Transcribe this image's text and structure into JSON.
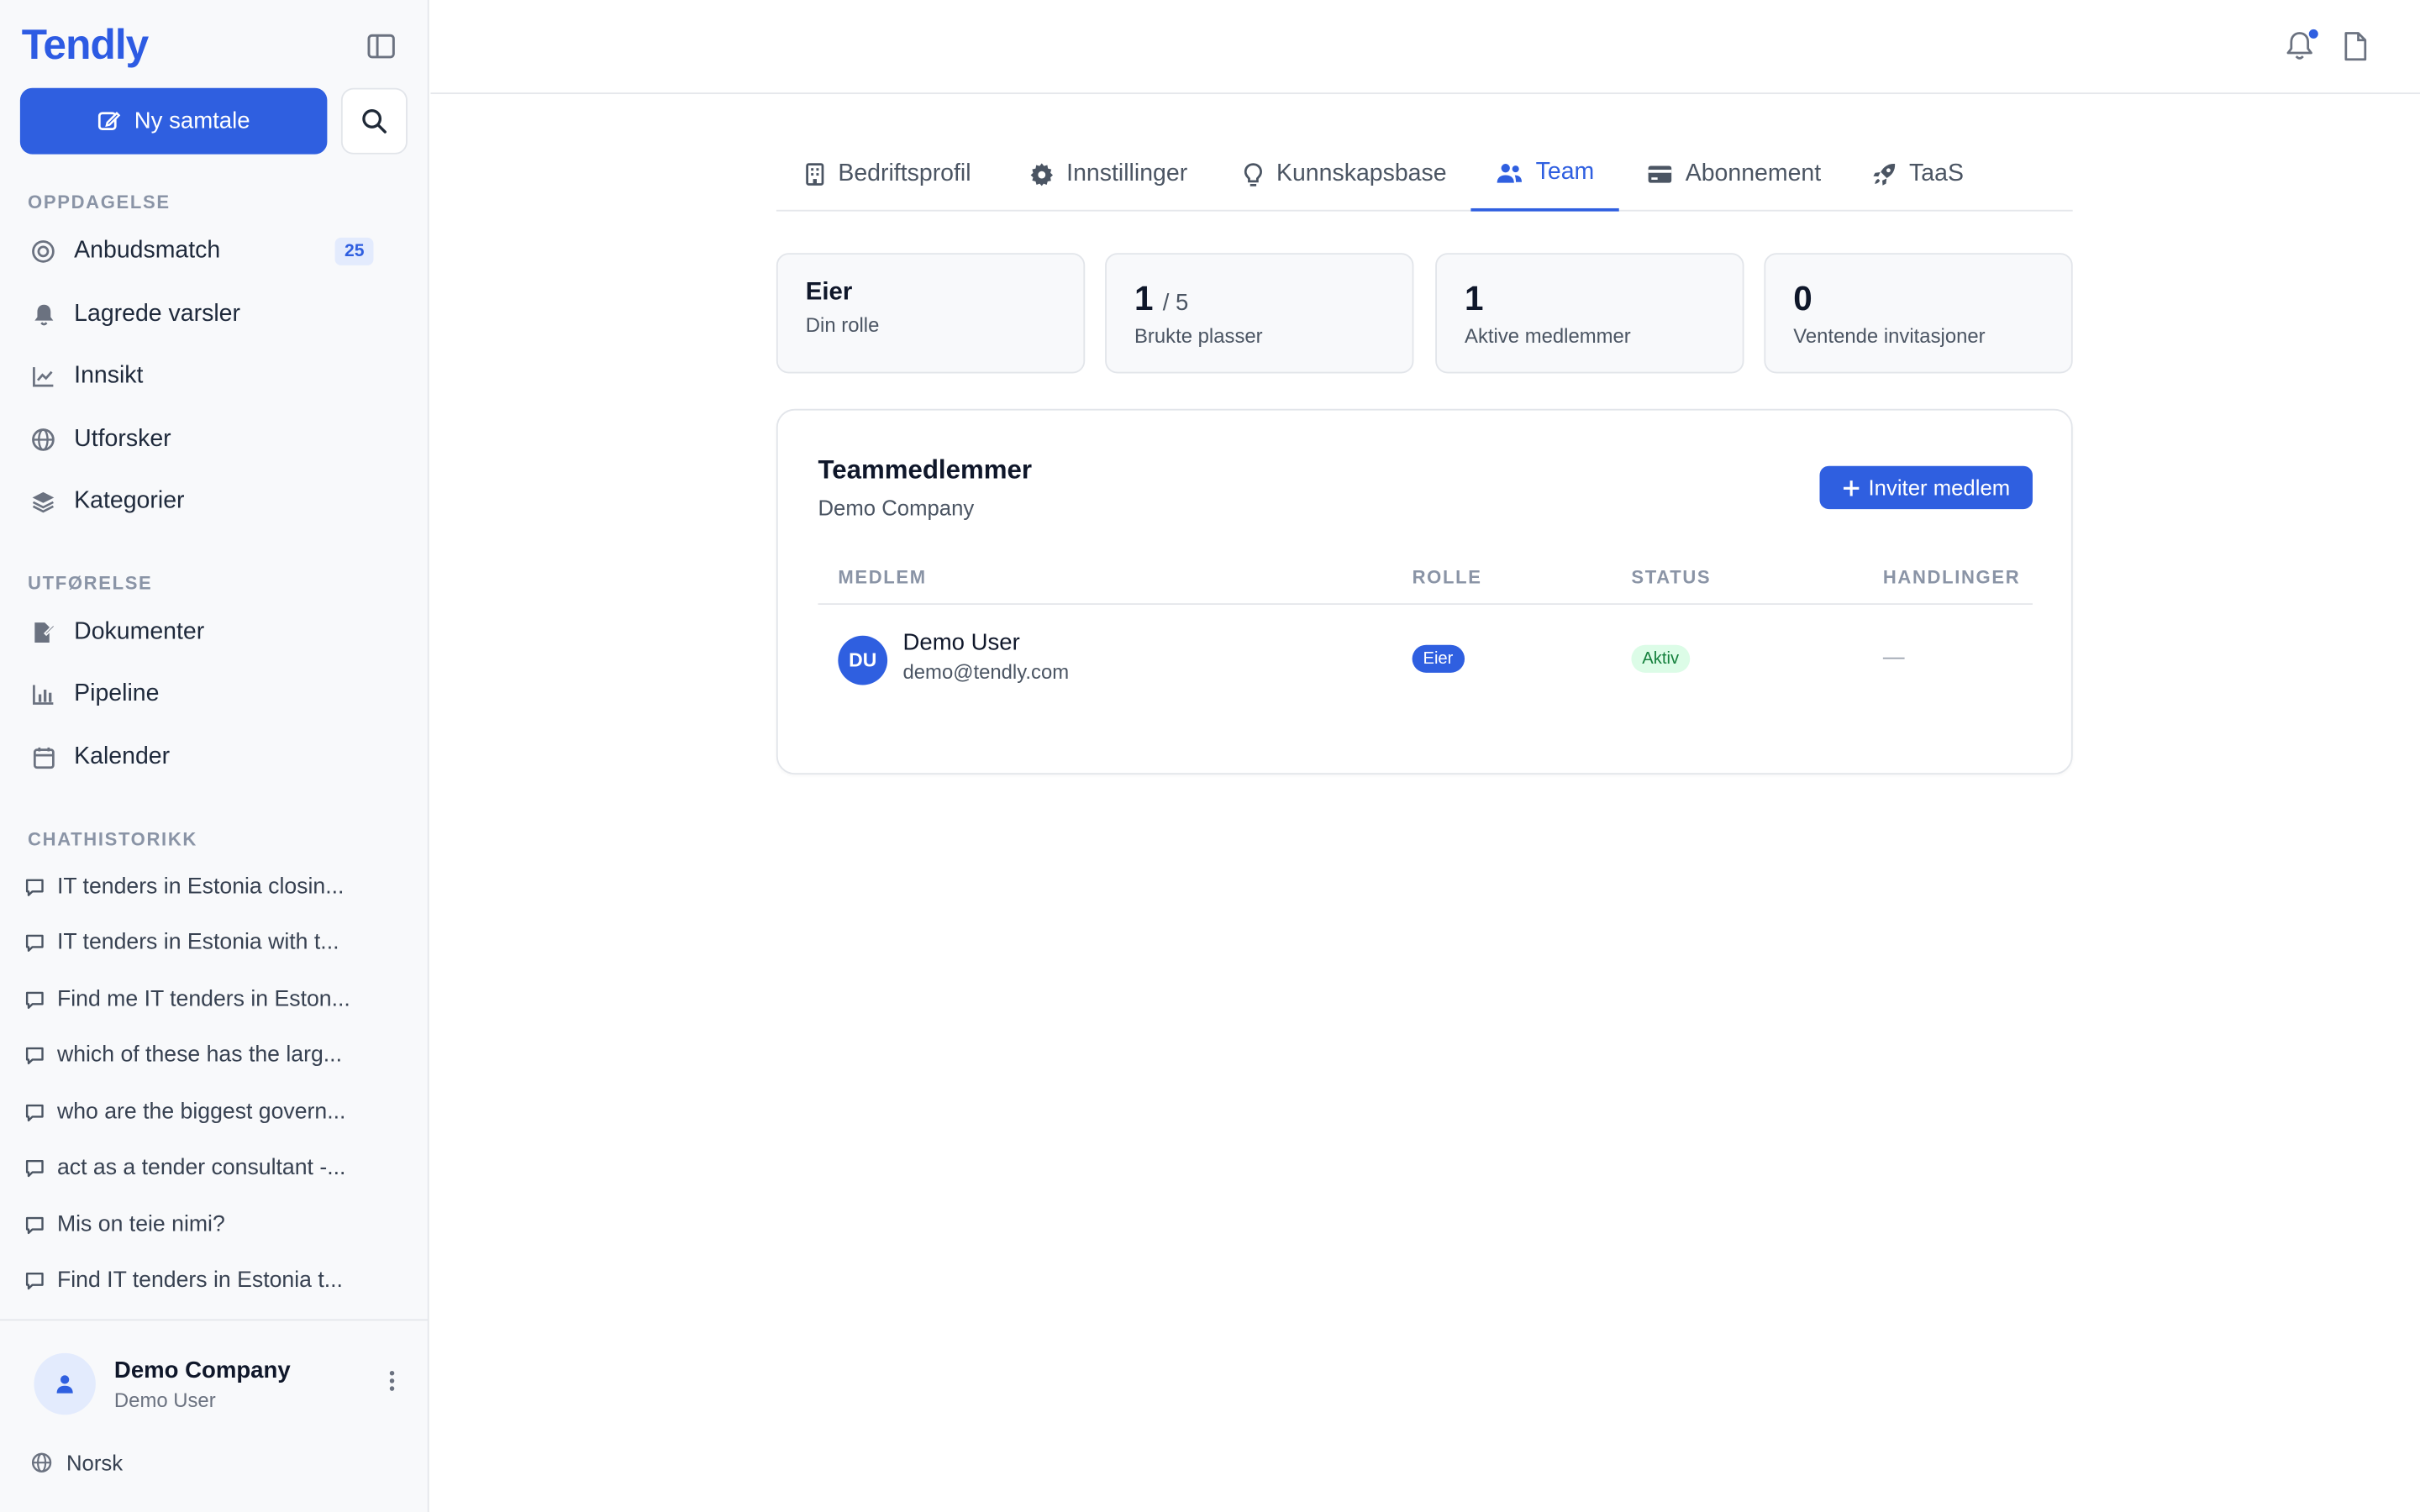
{
  "app": {
    "logo": "Tendly"
  },
  "sidebar": {
    "new_chat_label": "Ny samtale",
    "sections": {
      "discovery": "OPPDAGELSE",
      "execution": "UTFØRELSE",
      "history": "CHATHISTORIKK"
    },
    "discovery_items": [
      {
        "label": "Anbudsmatch",
        "icon": "target-icon",
        "badge": "25"
      },
      {
        "label": "Lagrede varsler",
        "icon": "bell-icon"
      },
      {
        "label": "Innsikt",
        "icon": "chart-line-icon"
      },
      {
        "label": "Utforsker",
        "icon": "globe-icon"
      },
      {
        "label": "Kategorier",
        "icon": "layers-icon"
      }
    ],
    "execution_items": [
      {
        "label": "Dokumenter",
        "icon": "file-edit-icon"
      },
      {
        "label": "Pipeline",
        "icon": "bar-chart-icon"
      },
      {
        "label": "Kalender",
        "icon": "calendar-icon"
      }
    ],
    "history_items": [
      "IT tenders in Estonia closin...",
      "IT tenders in Estonia with t...",
      "Find me IT tenders in Eston...",
      "which of these has the larg...",
      "who are the biggest govern...",
      "act as a tender consultant -...",
      "Mis on teie nimi?",
      "Find IT tenders in Estonia t..."
    ],
    "profile": {
      "name": "Demo Company",
      "sub": "Demo User"
    },
    "language": "Norsk"
  },
  "tabs": [
    {
      "label": "Bedriftsprofil",
      "icon": "building-icon"
    },
    {
      "label": "Innstillinger",
      "icon": "gear-icon"
    },
    {
      "label": "Kunnskapsbase",
      "icon": "lightbulb-icon"
    },
    {
      "label": "Team",
      "icon": "users-icon",
      "active": true
    },
    {
      "label": "Abonnement",
      "icon": "credit-card-icon"
    },
    {
      "label": "TaaS",
      "icon": "rocket-icon"
    }
  ],
  "stats": {
    "role": {
      "value": "Eier",
      "label": "Din rolle"
    },
    "seats": {
      "value": "1",
      "of": "/ 5",
      "label": "Brukte plasser"
    },
    "active": {
      "value": "1",
      "label": "Aktive medlemmer"
    },
    "pending": {
      "value": "0",
      "label": "Ventende invitasjoner"
    }
  },
  "team": {
    "title": "Teammedlemmer",
    "company": "Demo Company",
    "invite_label": "Inviter medlem",
    "columns": [
      "MEDLEM",
      "ROLLE",
      "STATUS",
      "HANDLINGER"
    ],
    "members": [
      {
        "initials": "DU",
        "name": "Demo User",
        "email": "demo@tendly.com",
        "role": "Eier",
        "status": "Aktiv",
        "actions": "—"
      }
    ]
  },
  "colors": {
    "accent": "#2f5fe0",
    "status_active_bg": "#dcfce7",
    "status_active_text": "#15803d"
  }
}
